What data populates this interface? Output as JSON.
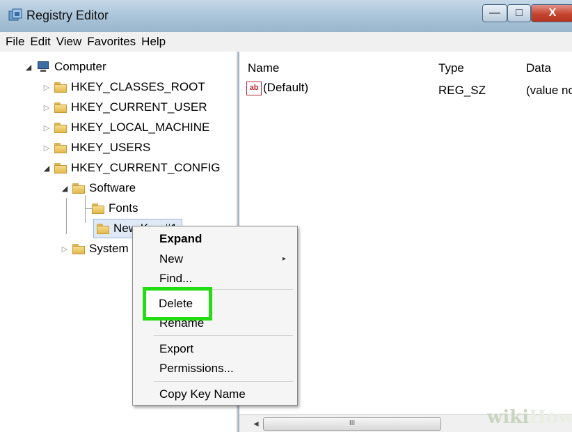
{
  "window": {
    "title": "Registry Editor",
    "close_glyph": "X",
    "minimize_glyph": "—",
    "maximize_glyph": "□"
  },
  "menubar": [
    "File",
    "Edit",
    "View",
    "Favorites",
    "Help"
  ],
  "tree": {
    "root": "Computer",
    "hives": [
      "HKEY_CLASSES_ROOT",
      "HKEY_CURRENT_USER",
      "HKEY_LOCAL_MACHINE",
      "HKEY_USERS",
      "HKEY_CURRENT_CONFIG"
    ],
    "software": "Software",
    "fonts": "Fonts",
    "new_key": "New Key #1",
    "system": "System"
  },
  "values": {
    "columns": {
      "name": "Name",
      "type": "Type",
      "data": "Data"
    },
    "rows": [
      {
        "icon": "ab",
        "name": "(Default)",
        "type": "REG_SZ",
        "data": "(value not set)"
      }
    ]
  },
  "scrollbar": {
    "grip": "III",
    "left_arrow": "◄"
  },
  "context_menu": {
    "items": [
      "Expand",
      "New",
      "Find...",
      "Delete",
      "Rename",
      "Export",
      "Permissions...",
      "Copy Key Name"
    ],
    "submenu_arrow": "▸"
  },
  "watermark": {
    "part1": "wiki",
    "part2": "How"
  },
  "colors": {
    "highlight": "#22dd11",
    "titlebar": "#a9c3d8",
    "close_button": "#c4452f"
  }
}
